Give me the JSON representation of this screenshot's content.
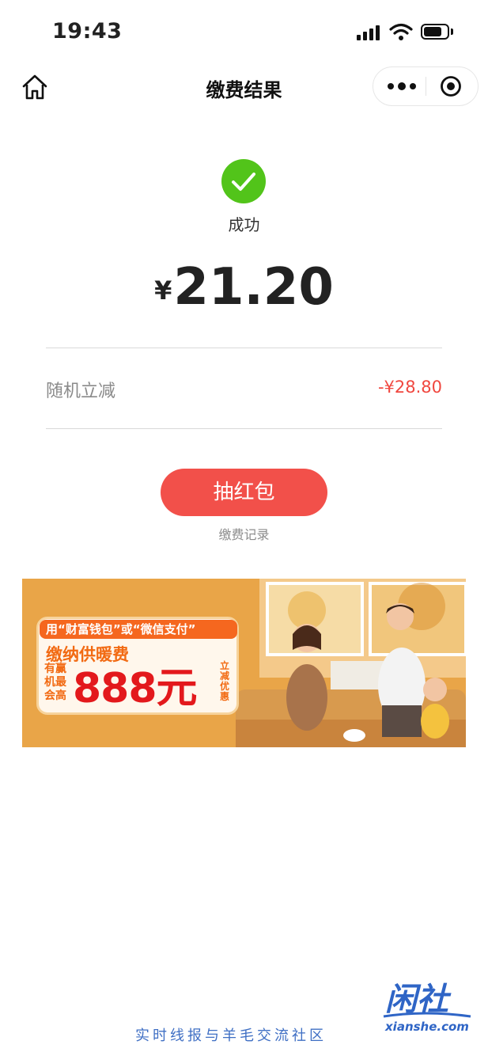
{
  "status_bar": {
    "time": "19:43"
  },
  "nav": {
    "title": "缴费结果"
  },
  "result": {
    "status": "成功",
    "currency": "¥",
    "amount": "21.20"
  },
  "discount": {
    "label": "随机立减",
    "value": "-¥28.80"
  },
  "actions": {
    "red_packet_label": "抽红包",
    "record_label": "缴费记录"
  },
  "banner": {
    "top_line": "用“财富钱包”或“微信支付”",
    "line2": "缴纳供暖费",
    "side_text": "有赢机最会高",
    "big_text": "888元",
    "vertical_text": "立减优惠"
  },
  "watermark": {
    "logo_text": "闲社",
    "logo_domain": "xianshe.com",
    "tagline": "实时线报与羊毛交流社区"
  },
  "colors": {
    "success": "#52c41a",
    "accent_red": "#f2504a",
    "discount_red": "#f0473f",
    "banner_orange": "#e9a548"
  }
}
